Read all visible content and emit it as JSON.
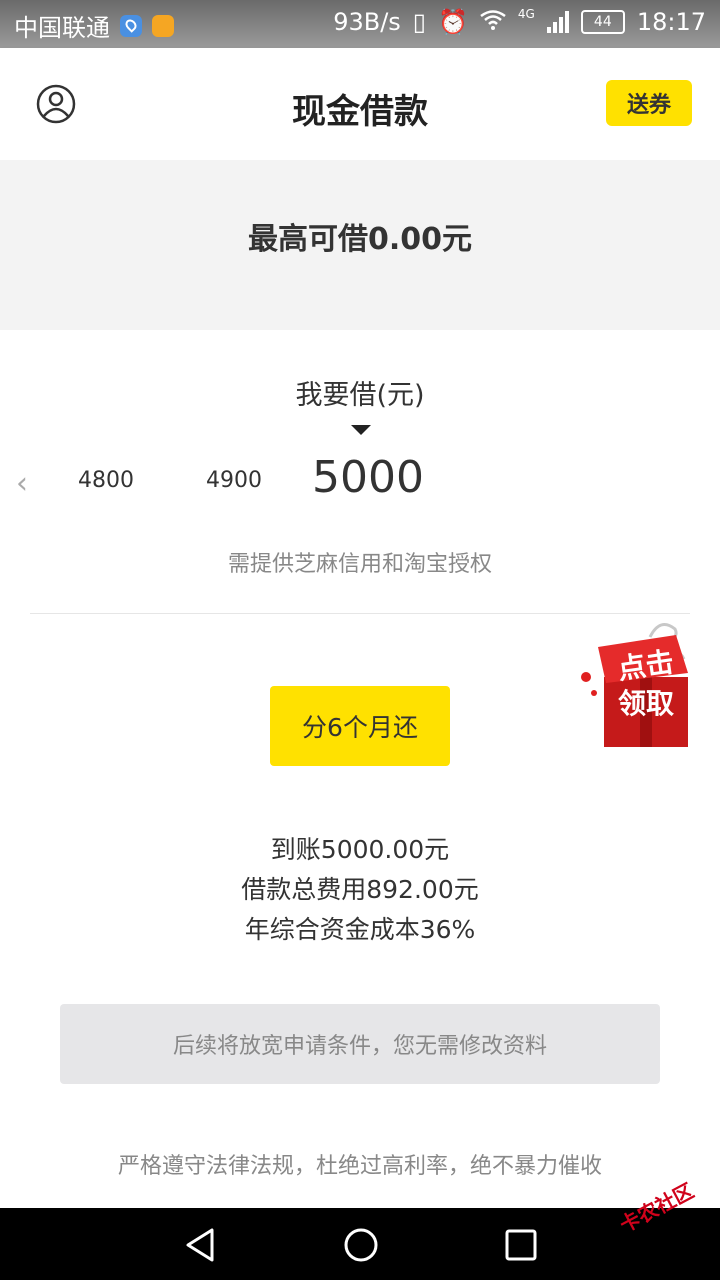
{
  "status_bar": {
    "carrier": "中国联通",
    "net_speed": "93B/s",
    "network_type": "4G",
    "battery": "44",
    "time": "18:17"
  },
  "header": {
    "title": "现金借款",
    "coupon_label": "送券"
  },
  "max_borrow": {
    "text": "最高可借0.00元"
  },
  "borrow": {
    "label": "我要借(元)",
    "options": [
      "4800",
      "4900"
    ],
    "selected": "5000",
    "auth_note": "需提供芝麻信用和淘宝授权"
  },
  "promo": {
    "line1": "点击",
    "line2": "领取"
  },
  "repay_button_label": "分6个月还",
  "summary": {
    "received": "到账5000.00元",
    "total_fee": "借款总费用892.00元",
    "annual_cost": "年综合资金成本36%"
  },
  "notice": "后续将放宽申请条件，您无需修改资料",
  "compliance": "严格遵守法律法规，杜绝过高利率，绝不暴力催收",
  "watermark": "卡农社区",
  "colors": {
    "accent": "#ffe100",
    "grey_bg": "#f3f3f3",
    "nav_bg": "#000000"
  }
}
